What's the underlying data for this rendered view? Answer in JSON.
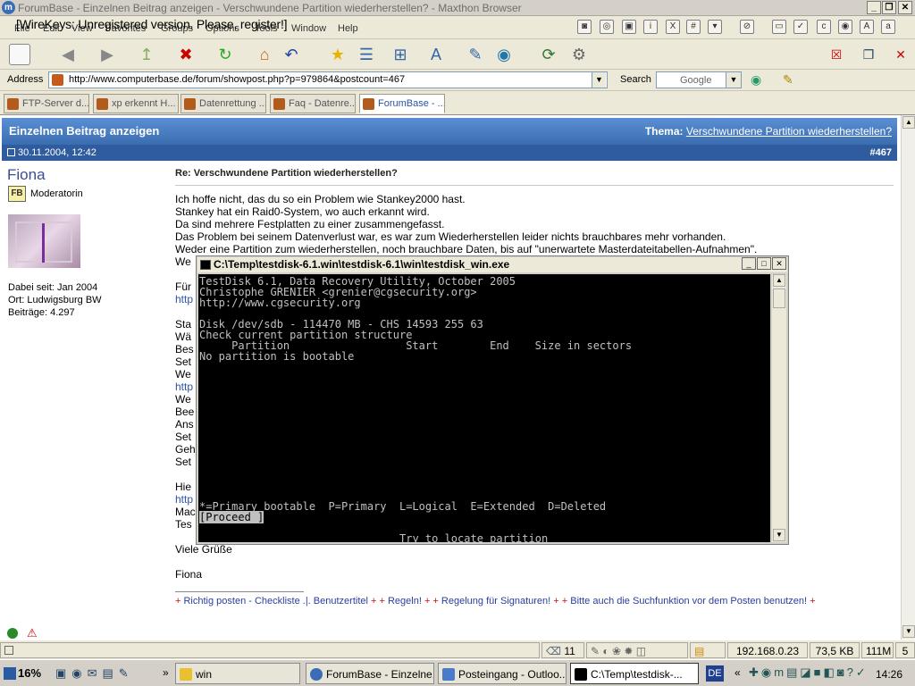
{
  "window": {
    "title": "ForumBase - Einzelnen Beitrag anzeigen - Verschwundene Partition wiederherstellen? - Maxthon Browser",
    "overlay_text": "[WireKeys: Unregistered version. Please, register!]"
  },
  "menubar": {
    "items": [
      "File",
      "Edit",
      "View",
      "Favorites",
      "Groups",
      "Options",
      "Tools",
      "Window",
      "Help"
    ]
  },
  "addressbar": {
    "label": "Address",
    "url": "http://www.computerbase.de/forum/showpost.php?p=979864&postcount=467",
    "search_label": "Search",
    "search_engine": "Google"
  },
  "tabs": [
    {
      "label": "FTP-Server d...",
      "active": false
    },
    {
      "label": "xp erkennt H...",
      "active": false
    },
    {
      "label": "Datenrettung ...",
      "active": false
    },
    {
      "label": "Faq - Datenre...",
      "active": false
    },
    {
      "label": "ForumBase - ...",
      "active": true
    }
  ],
  "page": {
    "header_title": "Einzelnen Beitrag anzeigen",
    "thema_label": "Thema:",
    "thema_link": "Verschwundene Partition wiederherstellen?",
    "date": "30.11.2004, 12:42",
    "post_number": "#467",
    "user": {
      "name": "Fiona",
      "rank": "Moderatorin",
      "joined": "Dabei seit: Jan 2004",
      "location": "Ort: Ludwigsburg BW",
      "posts": "Beiträge: 4.297"
    },
    "post": {
      "title": "Re: Verschwundene Partition wiederherstellen?",
      "lines": [
        "Ich hoffe nicht, das du so ein Problem wie Stankey2000 hast.",
        "Stankey hat ein Raid0-System, wo auch erkannt wird.",
        "Da sind mehrere Festplatten zu einer zusammengefasst.",
        "Das Problem bei seinem Datenverlust war, es war zum Wiederherstellen leider nichts brauchbares mehr vorhanden.",
        "Weder eine Partition zum wiederherstellen, noch brauchbare Daten, bis auf \"unerwartete Masterdateitabellen-Aufnahmen\".",
        "We"
      ],
      "partial_lines": [
        "Für",
        "http",
        "Sta",
        "Wä",
        "Bes",
        "Set",
        "We",
        "http",
        "We",
        "Bee",
        "Ans",
        "Set",
        "Geh",
        "Set",
        "Hie",
        "http",
        "Mac",
        "Tes"
      ],
      "greeting": "Viele Grüße",
      "signature_name": "Fiona"
    },
    "signature": {
      "text1": "Richtig posten - Checkliste .|. Benutzertitel",
      "text2": "Regeln!",
      "text3": "Regelung für Signaturen!",
      "text4": "Bitte auch die Suchfunktion vor dem Posten benutzen!"
    }
  },
  "console": {
    "title": "C:\\Temp\\testdisk-6.1.win\\testdisk-6.1\\win\\testdisk_win.exe",
    "lines": [
      "TestDisk 6.1, Data Recovery Utility, October 2005",
      "Christophe GRENIER <grenier@cgsecurity.org>",
      "http://www.cgsecurity.org",
      "",
      "Disk /dev/sdb - 114470 MB - CHS 14593 255 63",
      "Check current partition structure",
      "     Partition                  Start        End    Size in sectors",
      "No partition is bootable"
    ],
    "legend": "*=Primary bootable  P=Primary  L=Logical  E=Extended  D=Deleted",
    "proceed": "[Proceed ]",
    "status": "Try to locate partition"
  },
  "statusbar": {
    "count": "11",
    "ip": "192.168.0.23",
    "size": "73,5 KB",
    "memory": "111M",
    "extra": "5"
  },
  "taskbar": {
    "cpu": "16%",
    "tasks": [
      {
        "label": "win",
        "active": false
      },
      {
        "label": "ForumBase - Einzelne...",
        "active": false
      },
      {
        "label": "Posteingang - Outloo...",
        "active": false
      },
      {
        "label": "C:\\Temp\\testdisk-...",
        "active": true
      }
    ],
    "lang": "DE",
    "clock": "14:26"
  }
}
